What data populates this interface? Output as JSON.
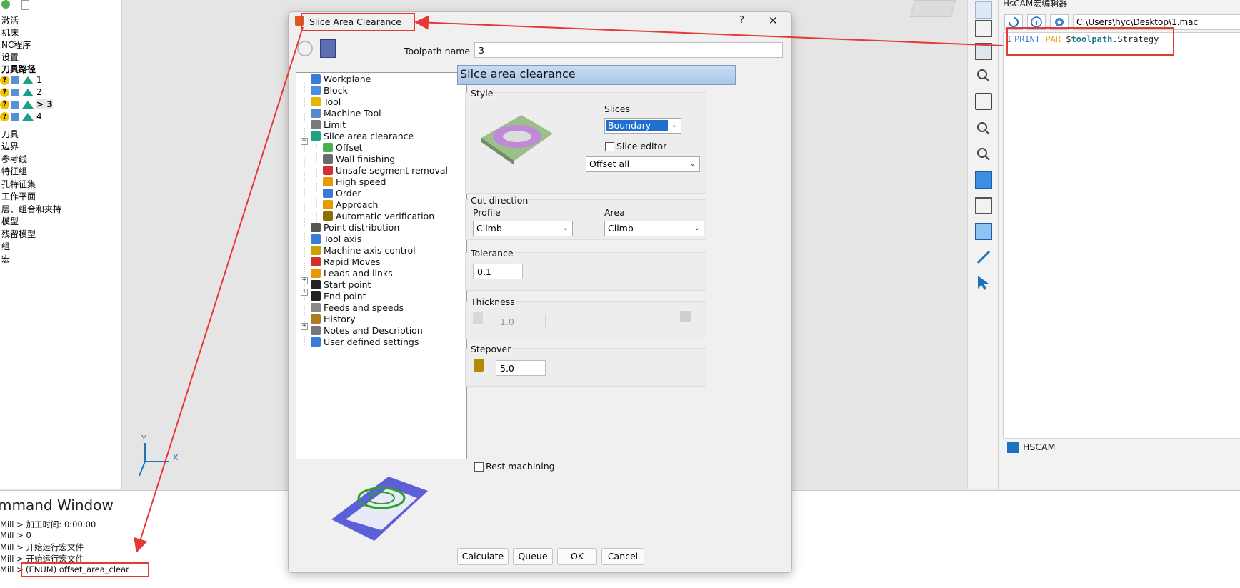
{
  "explorer": {
    "items": [
      {
        "label": "激活"
      },
      {
        "label": "机床"
      },
      {
        "label": "NC程序"
      },
      {
        "label": "设置"
      },
      {
        "label": "刀具路径"
      },
      {
        "label": "1"
      },
      {
        "label": "2"
      },
      {
        "label": "> 3"
      },
      {
        "label": "4"
      },
      {
        "label": "刀具"
      },
      {
        "label": "边界"
      },
      {
        "label": "参考线"
      },
      {
        "label": "特征组"
      },
      {
        "label": "孔特征集"
      },
      {
        "label": "工作平面"
      },
      {
        "label": "层、组合和夹持"
      },
      {
        "label": "模型"
      },
      {
        "label": "残留模型"
      },
      {
        "label": "组"
      },
      {
        "label": "宏"
      }
    ]
  },
  "viewport": {
    "axis_x": "X",
    "axis_y": "Y"
  },
  "command_window": {
    "title": "mmand Window",
    "lines": [
      "Mill > 加工时间:  0:00:00",
      "Mill > 0",
      "Mill > 开始运行宏文件",
      "Mill > 开始运行宏文件",
      "Mill > "
    ],
    "highlight": "(ENUM) offset_area_clear"
  },
  "dialog": {
    "title": "Slice Area Clearance",
    "help": "?",
    "close": "✕",
    "toolpath_name_label": "Toolpath name",
    "toolpath_name_value": "3",
    "tree": [
      {
        "label": "Workplane",
        "color": "#3a7bd5"
      },
      {
        "label": "Block",
        "color": "#4a90e2"
      },
      {
        "label": "Tool",
        "color": "#e8b400"
      },
      {
        "label": "Machine Tool",
        "color": "#5a8ac6"
      },
      {
        "label": "Limit",
        "color": "#7a7a7a"
      },
      {
        "label": "Slice area clearance",
        "color": "#20a080"
      },
      {
        "label": "Offset",
        "color": "#4caf50"
      },
      {
        "label": "Wall finishing",
        "color": "#6b6b6b"
      },
      {
        "label": "Unsafe segment removal",
        "color": "#d32f2f"
      },
      {
        "label": "High speed",
        "color": "#e69a00"
      },
      {
        "label": "Order",
        "color": "#3a7bd5"
      },
      {
        "label": "Approach",
        "color": "#e69a00"
      },
      {
        "label": "Automatic verification",
        "color": "#8d6e00"
      },
      {
        "label": "Point distribution",
        "color": "#555"
      },
      {
        "label": "Tool axis",
        "color": "#3a7bd5"
      },
      {
        "label": "Machine axis control",
        "color": "#c9a100"
      },
      {
        "label": "Rapid Moves",
        "color": "#d32f2f"
      },
      {
        "label": "Leads and links",
        "color": "#e69a00"
      },
      {
        "label": "Start point",
        "color": "#222"
      },
      {
        "label": "End point",
        "color": "#222"
      },
      {
        "label": "Feeds and speeds",
        "color": "#888"
      },
      {
        "label": "History",
        "color": "#b07a20"
      },
      {
        "label": "Notes and Description",
        "color": "#777"
      },
      {
        "label": "User defined settings",
        "color": "#3a7bd5"
      }
    ],
    "panel_title": "Slice area clearance",
    "style_label": "Style",
    "slices_label": "Slices",
    "slices_value": "Boundary",
    "slice_editor_label": "Slice editor",
    "offset_value": "Offset all",
    "cut_direction_label": "Cut direction",
    "profile_label": "Profile",
    "profile_value": "Climb",
    "area_label": "Area",
    "area_value": "Climb",
    "tolerance_label": "Tolerance",
    "tolerance_value": "0.1",
    "thickness_label": "Thickness",
    "thickness_value": "1.0",
    "stepover_label": "Stepover",
    "stepover_value": "5.0",
    "rest_machining_label": "Rest machining",
    "buttons": {
      "calculate": "Calculate",
      "queue": "Queue",
      "ok": "OK",
      "cancel": "Cancel"
    }
  },
  "macro_editor": {
    "title": "HsCAM宏编辑器",
    "path": "C:\\Users\\hyc\\Desktop\\1.mac",
    "line_no": "1",
    "code_kw1": "PRINT",
    "code_kw2": "PAR",
    "code_dollar": "$",
    "code_var": "toolpath",
    "code_rest": ".Strategy",
    "status": "HSCAM"
  },
  "colors": {
    "annotation_red": "#e53935",
    "accent_blue": "#1e73be"
  }
}
